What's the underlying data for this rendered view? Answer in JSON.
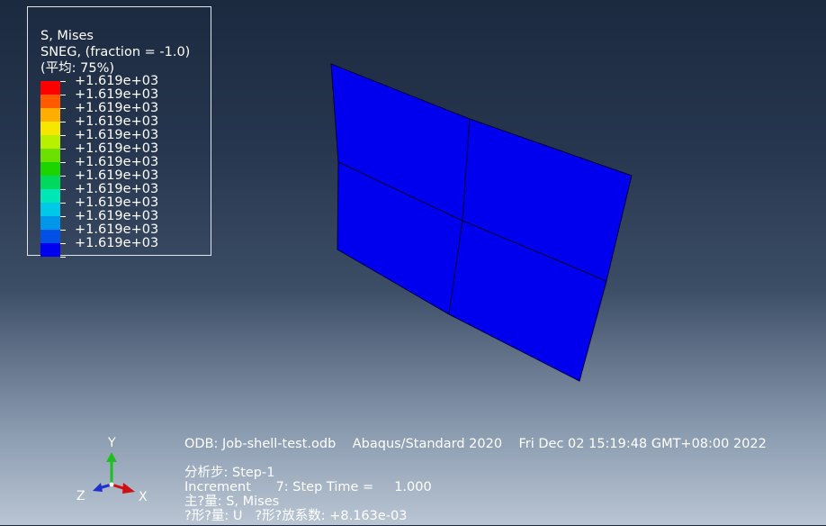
{
  "legend": {
    "line1": "S, Mises",
    "line2": "SNEG, (fraction = -1.0)",
    "line3": "(平均: 75%)",
    "colors": [
      "#ff0000",
      "#ff5a00",
      "#ffad00",
      "#f5e700",
      "#b8f000",
      "#6ce000",
      "#1ed400",
      "#00d85e",
      "#00e6b4",
      "#00c8e8",
      "#0097ea",
      "#0050e6",
      "#0000f0"
    ],
    "labels": [
      "+1.619e+03",
      "+1.619e+03",
      "+1.619e+03",
      "+1.619e+03",
      "+1.619e+03",
      "+1.619e+03",
      "+1.619e+03",
      "+1.619e+03",
      "+1.619e+03",
      "+1.619e+03",
      "+1.619e+03",
      "+1.619e+03",
      "+1.619e+03"
    ]
  },
  "model": {
    "fill_color": "#0000ee",
    "edge_color": "#00003a"
  },
  "triad": {
    "y_label": "Y",
    "z_label": "Z",
    "x_label": "X",
    "y_color": "#1fbf1f",
    "x_color": "#d01010",
    "z_color": "#2030d0"
  },
  "info": {
    "odb_line": "ODB: Job-shell-test.odb    Abaqus/Standard 2020    Fri Dec 02 15:19:48 GMT+08:00 2022",
    "step_line": "分析步: Step-1",
    "increment_line": "Increment      7: Step Time =     1.000",
    "primary_var_line": "主?量: S, Mises",
    "deformed_var_line": "?形?量: U   ?形?放系数: +8.163e-03"
  }
}
